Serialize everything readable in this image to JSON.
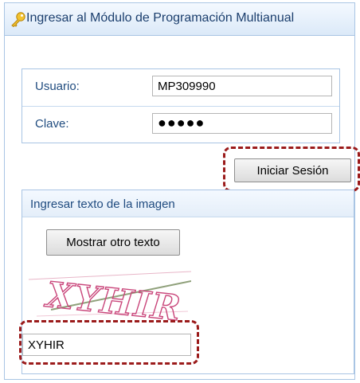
{
  "header": {
    "title": "Ingresar al Módulo de Programación Multianual",
    "icon": "key-icon"
  },
  "login": {
    "username_label": "Usuario:",
    "username_value": "MP309990",
    "password_label": "Clave:",
    "password_value": "●●●●●",
    "submit_label": "Iniciar Sesión"
  },
  "captcha": {
    "section_title": "Ingresar texto de la imagen",
    "refresh_label": "Mostrar otro texto",
    "image_text": "XYHIR",
    "input_value": "XYHIR"
  },
  "colors": {
    "accent": "#1f4b7f",
    "border": "#a9c5e4",
    "highlight": "#9b1b1b"
  }
}
